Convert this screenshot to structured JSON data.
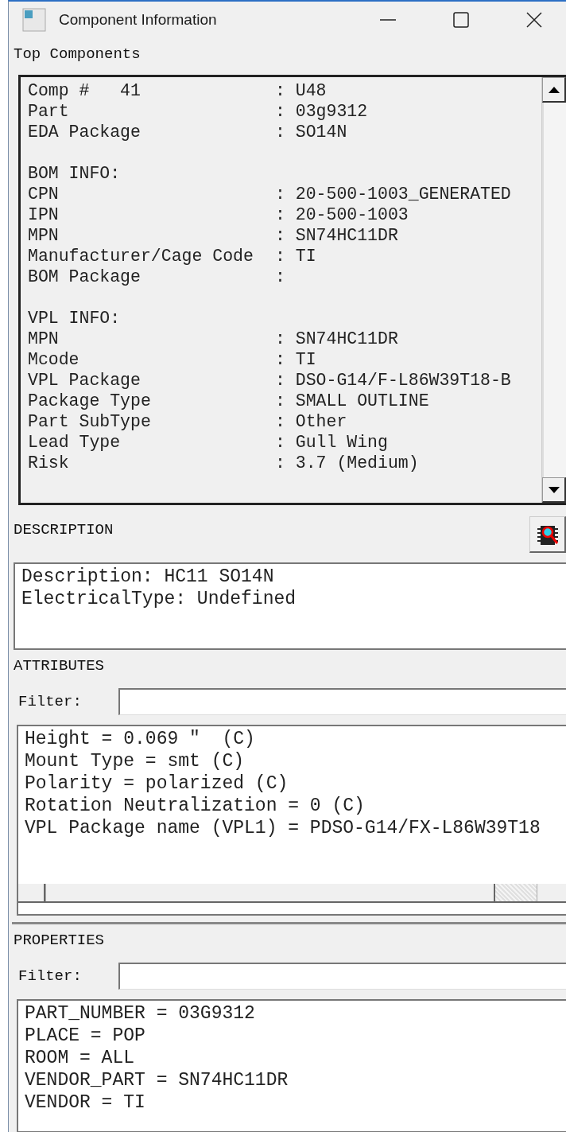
{
  "window": {
    "title": "Component Information"
  },
  "top_components": {
    "label": "Top Components",
    "rows": [
      {
        "kind": "field",
        "label": "Comp #   41",
        "value": ": U48"
      },
      {
        "kind": "field",
        "label": "Part",
        "value": ": 03g9312"
      },
      {
        "kind": "field",
        "label": "EDA Package",
        "value": ": SO14N"
      },
      {
        "kind": "heading",
        "label": "BOM INFO:"
      },
      {
        "kind": "field",
        "label": "CPN",
        "value": ": 20-500-1003_GENERATED"
      },
      {
        "kind": "field",
        "label": "IPN",
        "value": ": 20-500-1003"
      },
      {
        "kind": "field",
        "label": "MPN",
        "value": ": SN74HC11DR"
      },
      {
        "kind": "field",
        "label": "Manufacturer/Cage Code",
        "value": ": TI"
      },
      {
        "kind": "field",
        "label": "BOM Package",
        "value": ":"
      },
      {
        "kind": "heading",
        "label": "VPL INFO:"
      },
      {
        "kind": "field",
        "label": "MPN",
        "value": ": SN74HC11DR"
      },
      {
        "kind": "field",
        "label": "Mcode",
        "value": ": TI"
      },
      {
        "kind": "field",
        "label": "VPL Package",
        "value": ": DSO-G14/F-L86W39T18-B"
      },
      {
        "kind": "field",
        "label": "Package Type",
        "value": ": SMALL OUTLINE"
      },
      {
        "kind": "field",
        "label": "Part SubType",
        "value": ": Other"
      },
      {
        "kind": "field",
        "label": "Lead Type",
        "value": ": Gull Wing"
      },
      {
        "kind": "field",
        "label": "Risk",
        "value": ": 3.7 (Medium)"
      }
    ]
  },
  "description": {
    "label": "DESCRIPTION",
    "lines": [
      "Description: HC11 SO14N",
      "ElectricalType: Undefined"
    ]
  },
  "attributes": {
    "label": "ATTRIBUTES",
    "filter": {
      "label": "Filter:"
    },
    "lines": [
      "Height = 0.069 \"  (C)",
      "Mount Type = smt (C)",
      "Polarity = polarized (C)",
      "Rotation Neutralization = 0 (C)",
      "VPL Package name (VPL1) = PDSO-G14/FX-L86W39T18"
    ]
  },
  "properties": {
    "label": "PROPERTIES",
    "filter": {
      "label": "Filter:"
    },
    "lines": [
      "PART_NUMBER = 03G9312",
      "PLACE = POP",
      "ROOM = ALL",
      "VENDOR_PART = SN74HC11DR",
      "VENDOR = TI"
    ]
  }
}
